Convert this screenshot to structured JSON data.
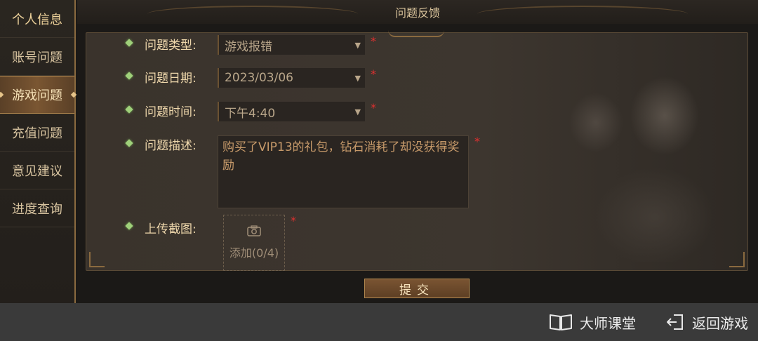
{
  "sidebar": {
    "items": [
      {
        "label": "个人信息"
      },
      {
        "label": "账号问题"
      },
      {
        "label": "游戏问题"
      },
      {
        "label": "充值问题"
      },
      {
        "label": "意见建议"
      },
      {
        "label": "进度查询"
      }
    ]
  },
  "header": {
    "title": "问题反馈"
  },
  "form": {
    "type": {
      "label": "问题类型:",
      "value": "游戏报错"
    },
    "date": {
      "label": "问题日期:",
      "value": "2023/03/06"
    },
    "time": {
      "label": "问题时间:",
      "value": "下午4:40"
    },
    "description": {
      "label": "问题描述:",
      "value": "购买了VIP13的礼包，钻石消耗了却没获得奖励"
    },
    "upload": {
      "label": "上传截图:",
      "text": "添加(0/4)"
    },
    "required_mark": "*"
  },
  "submit_label": "提交",
  "bottom": {
    "master_class": "大师课堂",
    "return_game": "返回游戏"
  },
  "colors": {
    "accent": "#b58a50",
    "required": "#e03030",
    "bullet": "#9fd07a"
  }
}
